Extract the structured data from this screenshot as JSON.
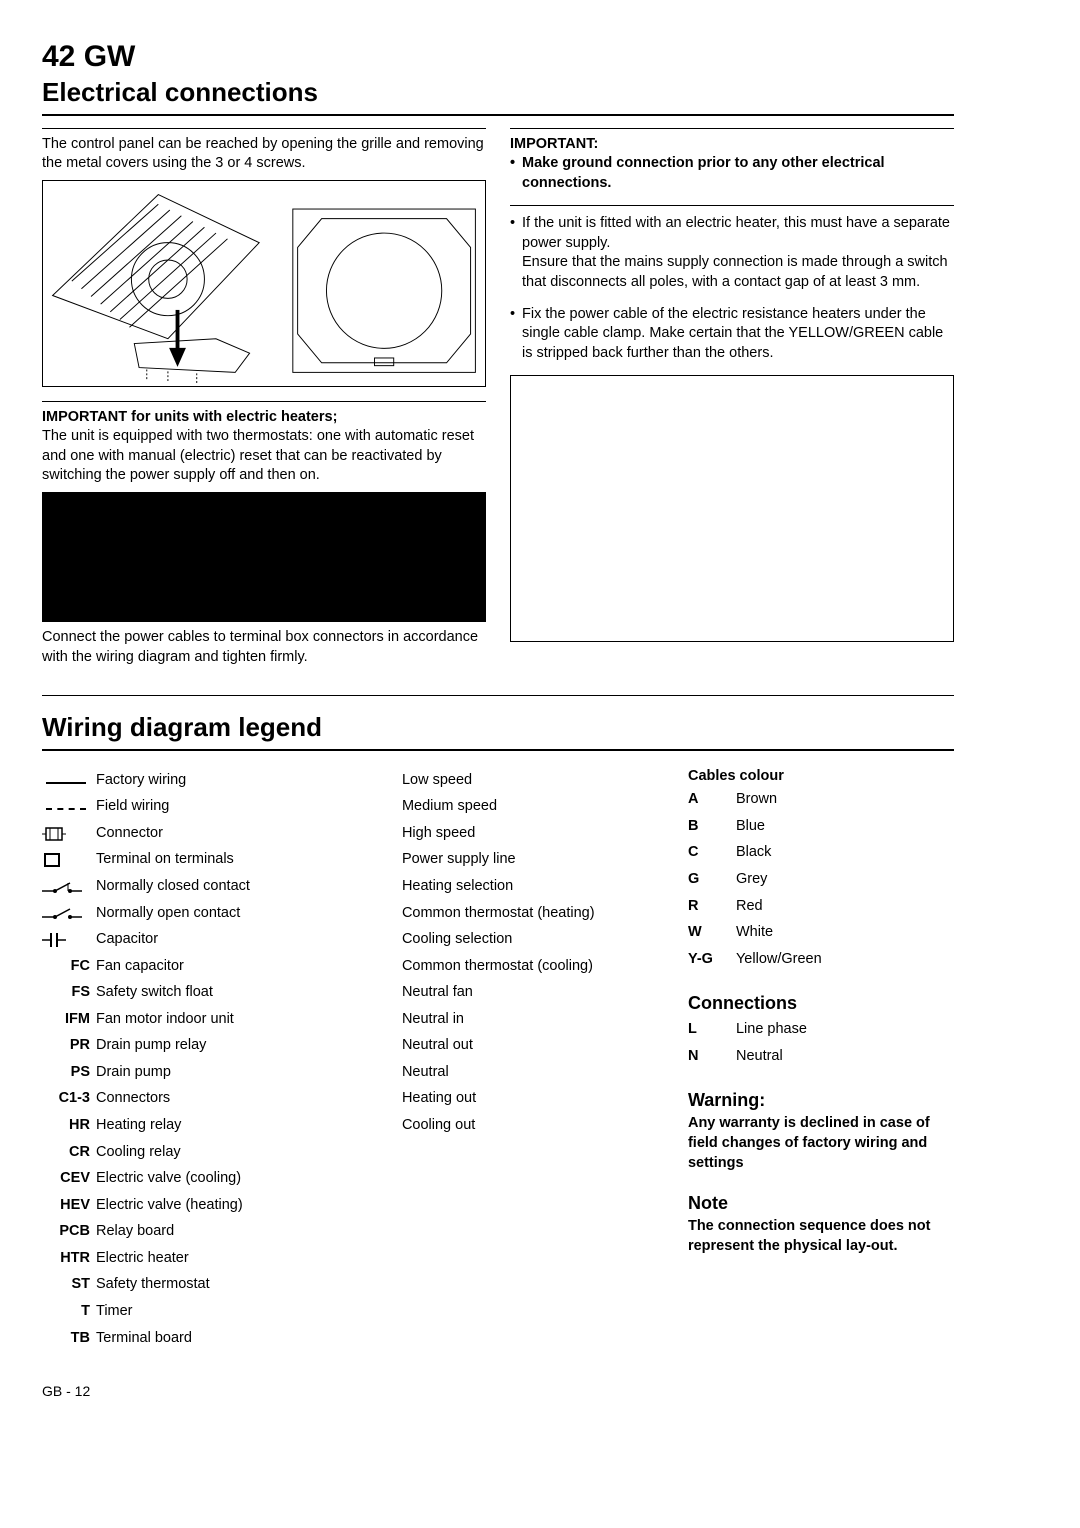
{
  "header": {
    "model": "42 GW",
    "section": "Electrical connections"
  },
  "left": {
    "intro": "The control panel can be reached by opening the grille and removing the metal covers using the 3 or 4 screws.",
    "imp1_heading": "IMPORTANT for units with electric heaters;",
    "imp1_body": "The unit is equipped with two thermostats: one with automatic reset and one with manual (electric) reset that can be reactivated by switching the power supply off and then on.",
    "connect_note": "Connect the power cables to terminal box connectors in accordance with the wiring diagram and tighten firmly."
  },
  "right": {
    "imp_heading": "IMPORTANT:",
    "imp_bullet": "Make ground connection prior to any other electrical connections.",
    "b1_l1": "If the unit is fitted with an electric heater, this must have a separate power supply.",
    "b1_l2": "Ensure that the mains supply connection is made through a switch that disconnects all poles, with a contact gap of at least 3 mm.",
    "b2": "Fix the power cable of the electric resistance heaters under the single cable clamp. Make certain that the YELLOW/GREEN cable is stripped back further than the others."
  },
  "legend": {
    "title": "Wiring diagram legend",
    "symbols": [
      {
        "label": "Factory wiring"
      },
      {
        "label": "Field wiring"
      },
      {
        "label": "Connector"
      },
      {
        "label": "Terminal on terminals"
      },
      {
        "label": "Normally closed contact"
      },
      {
        "label": "Normally open contact"
      },
      {
        "label": "Capacitor"
      }
    ],
    "codes": [
      {
        "k": "FC",
        "v": "Fan capacitor"
      },
      {
        "k": "FS",
        "v": "Safety switch float"
      },
      {
        "k": "IFM",
        "v": "Fan motor indoor unit"
      },
      {
        "k": "PR",
        "v": "Drain pump relay"
      },
      {
        "k": "PS",
        "v": "Drain pump"
      },
      {
        "k": "C1-3",
        "v": "Connectors"
      },
      {
        "k": "HR",
        "v": "Heating relay"
      },
      {
        "k": "CR",
        "v": "Cooling relay"
      },
      {
        "k": "CEV",
        "v": "Electric valve (cooling)"
      },
      {
        "k": "HEV",
        "v": "Electric valve (heating)"
      },
      {
        "k": "PCB",
        "v": "Relay board"
      },
      {
        "k": "HTR",
        "v": "Electric heater"
      },
      {
        "k": "ST",
        "v": "Safety thermostat"
      },
      {
        "k": "T",
        "v": "Timer"
      },
      {
        "k": "TB",
        "v": "Terminal board"
      }
    ],
    "col2": [
      "Low speed",
      "Medium speed",
      "High speed",
      "Power supply line",
      "Heating selection",
      "Common thermostat (heating)",
      "Cooling selection",
      "Common thermostat (cooling)",
      "Neutral fan",
      "Neutral in",
      "Neutral out",
      "Neutral",
      "Heating out",
      "Cooling out"
    ],
    "cables_heading": "Cables colour",
    "cables": [
      {
        "k": "A",
        "v": "Brown"
      },
      {
        "k": "B",
        "v": "Blue"
      },
      {
        "k": "C",
        "v": "Black"
      },
      {
        "k": "G",
        "v": "Grey"
      },
      {
        "k": "R",
        "v": "Red"
      },
      {
        "k": "W",
        "v": "White"
      },
      {
        "k": "Y-G",
        "v": "Yellow/Green"
      }
    ],
    "connections_heading": "Connections",
    "connections": [
      {
        "k": "L",
        "v": "Line phase"
      },
      {
        "k": "N",
        "v": "Neutral"
      }
    ],
    "warning_heading": "Warning:",
    "warning_body": "Any warranty is declined in case of field changes of factory wiring and settings",
    "note_heading": "Note",
    "note_body": "The connection sequence does not represent the physical lay-out."
  },
  "footer": "GB - 12"
}
